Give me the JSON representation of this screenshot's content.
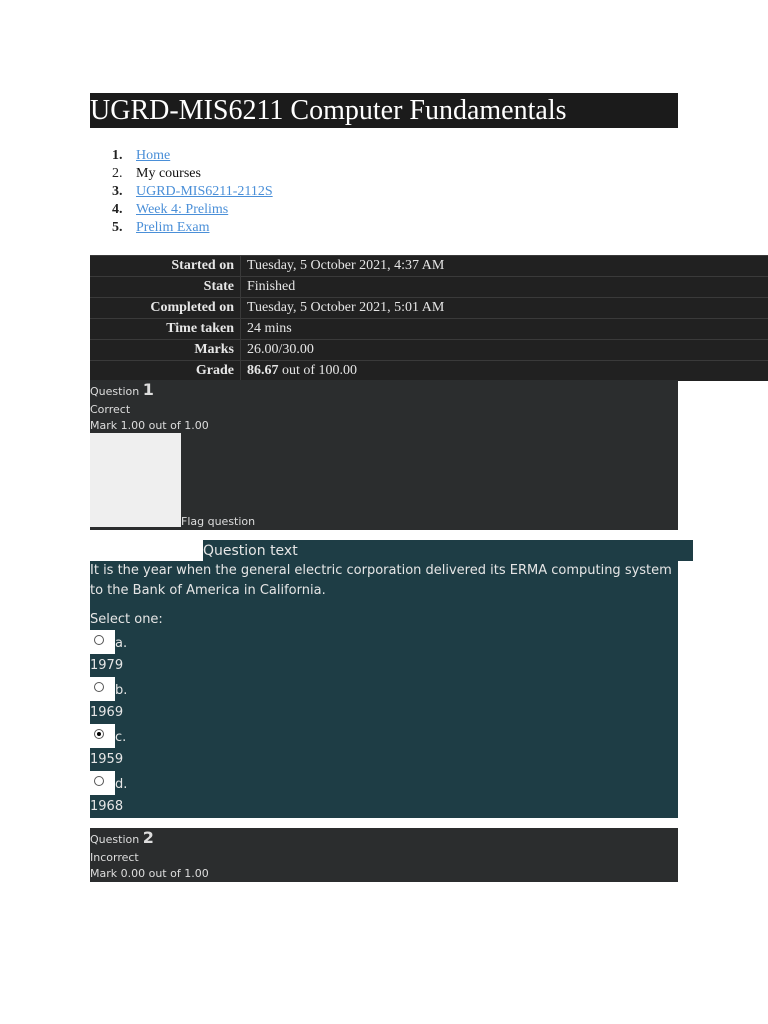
{
  "title": "UGRD-MIS6211 Computer Fundamentals",
  "breadcrumb": [
    {
      "num": "1.",
      "label": "Home",
      "link": true
    },
    {
      "num": "2.",
      "label": "My courses",
      "link": false
    },
    {
      "num": "3.",
      "label": "UGRD-MIS6211-2112S",
      "link": true
    },
    {
      "num": "4.",
      "label": "Week 4: Prelims",
      "link": true
    },
    {
      "num": "5.",
      "label": "Prelim Exam",
      "link": true
    }
  ],
  "summary": [
    {
      "label": "Started on",
      "value": "Tuesday, 5 October 2021, 4:37 AM"
    },
    {
      "label": "State",
      "value": "Finished"
    },
    {
      "label": "Completed on",
      "value": "Tuesday, 5 October 2021, 5:01 AM"
    },
    {
      "label": "Time taken",
      "value": "24 mins"
    },
    {
      "label": "Marks",
      "value": "26.00/30.00"
    },
    {
      "label": "Grade",
      "value_bold": "86.67",
      "value": " out of 100.00"
    }
  ],
  "q1": {
    "prefix": "Question ",
    "num": "1",
    "status": "Correct",
    "mark": "Mark 1.00 out of 1.00",
    "flag": "Flag question"
  },
  "qtext": {
    "heading": "Question text",
    "text": "It is the year when the general electric corporation delivered its ERMA computing system to the Bank of America in California.",
    "select": "Select one:",
    "options": [
      {
        "letter": "a.",
        "value": "1979",
        "selected": false
      },
      {
        "letter": "b.",
        "value": "1969",
        "selected": false
      },
      {
        "letter": "c.",
        "value": "1959",
        "selected": true
      },
      {
        "letter": "d.",
        "value": "1968",
        "selected": false
      }
    ]
  },
  "q2": {
    "prefix": "Question ",
    "num": "2",
    "status": "Incorrect",
    "mark": "Mark 0.00 out of 1.00"
  }
}
